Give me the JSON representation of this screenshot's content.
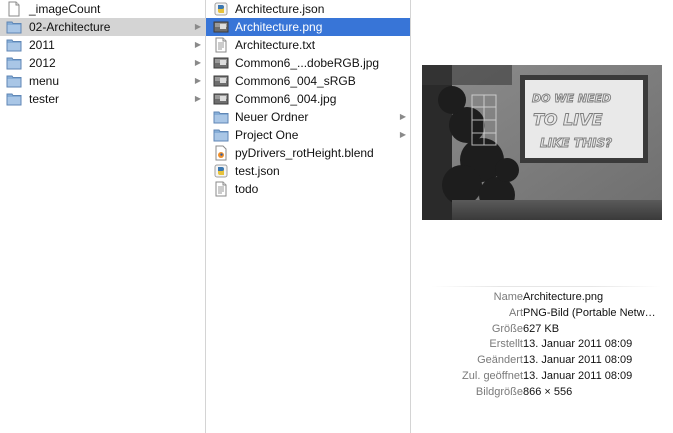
{
  "column1": {
    "items": [
      {
        "icon": "document-icon",
        "label": "_imageCount",
        "folder": false
      },
      {
        "icon": "folder-icon",
        "label": "02-Architecture",
        "folder": true,
        "selected": true
      },
      {
        "icon": "folder-icon",
        "label": "2011",
        "folder": true
      },
      {
        "icon": "folder-icon",
        "label": "2012",
        "folder": true
      },
      {
        "icon": "folder-icon",
        "label": "menu",
        "folder": true
      },
      {
        "icon": "folder-icon",
        "label": "tester",
        "folder": true
      }
    ]
  },
  "column2": {
    "items": [
      {
        "icon": "python-file-icon",
        "label": "Architecture.json",
        "folder": false
      },
      {
        "icon": "image-thumbnail-icon",
        "label": "Architecture.png",
        "folder": false,
        "selected": true
      },
      {
        "icon": "text-document-icon",
        "label": "Architecture.txt",
        "folder": false
      },
      {
        "icon": "image-thumbnail-icon",
        "label": "Common6_...dobeRGB.jpg",
        "folder": false
      },
      {
        "icon": "image-thumbnail-icon",
        "label": "Common6_004_sRGB",
        "folder": false
      },
      {
        "icon": "image-thumbnail-icon",
        "label": "Common6_004.jpg",
        "folder": false
      },
      {
        "icon": "folder-icon",
        "label": "Neuer Ordner",
        "folder": true
      },
      {
        "icon": "folder-icon",
        "label": "Project One",
        "folder": true
      },
      {
        "icon": "blend-file-icon",
        "label": "pyDrivers_rotHeight.blend",
        "folder": false
      },
      {
        "icon": "python-file-icon",
        "label": "test.json",
        "folder": false
      },
      {
        "icon": "text-document-icon",
        "label": "todo",
        "folder": false
      }
    ]
  },
  "preview": {
    "sign_text": [
      "DO WE NEED",
      "TO LIVE",
      "LIKE THIS?"
    ],
    "info": [
      {
        "key": "Name",
        "value": "Architecture.png"
      },
      {
        "key": "Art",
        "value": "PNG-Bild (Portable Netw…"
      },
      {
        "key": "Größe",
        "value": "627 KB"
      },
      {
        "key": "Erstellt",
        "value": "13. Januar 2011 08:09"
      },
      {
        "key": "Geändert",
        "value": "13. Januar 2011 08:09"
      },
      {
        "key": "Zul. geöffnet",
        "value": "13. Januar 2011 08:09"
      },
      {
        "key": "Bildgröße",
        "value": "866 × 556"
      }
    ]
  },
  "colors": {
    "selection_active": "#3875d7",
    "selection_inactive": "#d4d4d4",
    "folder_blue": "#7fa7d4"
  }
}
